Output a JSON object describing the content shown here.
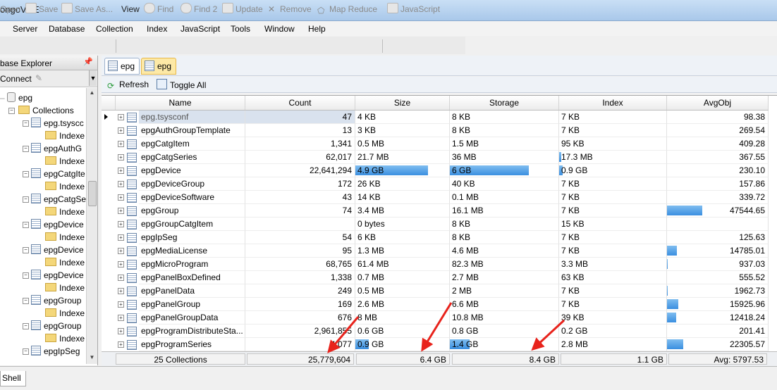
{
  "window": {
    "title": "ongoVUE"
  },
  "menu": [
    "Server",
    "Database",
    "Collection",
    "Index",
    "JavaScript",
    "Tools",
    "Window",
    "Help"
  ],
  "toolbar": {
    "open": "Open",
    "save": "Save",
    "save_as": "Save As...",
    "view": "View",
    "find": "Find",
    "find2": "Find 2",
    "update": "Update",
    "remove": "Remove",
    "map_reduce": "Map Reduce",
    "javascript": "JavaScript"
  },
  "explorer": {
    "title": "base Explorer",
    "connect": "Connect",
    "db": "epg",
    "collections_label": "Collections",
    "items": [
      "epg.tsyscc",
      "epgAuthG",
      "epgCatgIte",
      "epgCatgSe",
      "epgDevice",
      "epgDevice",
      "epgDevice",
      "epgGroup",
      "epgGroup",
      "epgIpSeg"
    ],
    "indexes_label": "Indexe"
  },
  "tabs": [
    "epg",
    "epg"
  ],
  "actions": {
    "refresh": "Refresh",
    "toggle_all": "Toggle All"
  },
  "grid": {
    "columns": [
      "Name",
      "Count",
      "Size",
      "Storage",
      "Index",
      "AvgObj"
    ],
    "rows": [
      {
        "name": "epg.tsysconf",
        "count": "47",
        "size": "4 KB",
        "storage": "8 KB",
        "index": "7 KB",
        "avg": "98.38"
      },
      {
        "name": "epgAuthGroupTemplate",
        "count": "13",
        "size": "3 KB",
        "storage": "8 KB",
        "index": "7 KB",
        "avg": "269.54"
      },
      {
        "name": "epgCatgItem",
        "count": "1,341",
        "size": "0.5 MB",
        "storage": "1.5 MB",
        "index": "95 KB",
        "avg": "409.28"
      },
      {
        "name": "epgCatgSeries",
        "count": "62,017",
        "size": "21.7 MB",
        "storage": "36 MB",
        "index": "17.3 MB",
        "avg": "367.55"
      },
      {
        "name": "epgDevice",
        "count": "22,641,294",
        "size": "4.9 GB",
        "storage": "6 GB",
        "index": "0.9 GB",
        "avg": "230.10"
      },
      {
        "name": "epgDeviceGroup",
        "count": "172",
        "size": "26 KB",
        "storage": "40 KB",
        "index": "7 KB",
        "avg": "157.86"
      },
      {
        "name": "epgDeviceSoftware",
        "count": "43",
        "size": "14 KB",
        "storage": "0.1 MB",
        "index": "7 KB",
        "avg": "339.72"
      },
      {
        "name": "epgGroup",
        "count": "74",
        "size": "3.4 MB",
        "storage": "16.1 MB",
        "index": "7 KB",
        "avg": "47544.65"
      },
      {
        "name": "epgGroupCatgItem",
        "count": "",
        "size": "0 bytes",
        "storage": "8 KB",
        "index": "15 KB",
        "avg": ""
      },
      {
        "name": "epgIpSeg",
        "count": "54",
        "size": "6 KB",
        "storage": "8 KB",
        "index": "7 KB",
        "avg": "125.63"
      },
      {
        "name": "epgMediaLicense",
        "count": "95",
        "size": "1.3 MB",
        "storage": "4.6 MB",
        "index": "7 KB",
        "avg": "14785.01"
      },
      {
        "name": "epgMicroProgram",
        "count": "68,765",
        "size": "61.4 MB",
        "storage": "82.3 MB",
        "index": "3.3 MB",
        "avg": "937.03"
      },
      {
        "name": "epgPanelBoxDefined",
        "count": "1,338",
        "size": "0.7 MB",
        "storage": "2.7 MB",
        "index": "63 KB",
        "avg": "555.52"
      },
      {
        "name": "epgPanelData",
        "count": "249",
        "size": "0.5 MB",
        "storage": "2 MB",
        "index": "7 KB",
        "avg": "1962.73"
      },
      {
        "name": "epgPanelGroup",
        "count": "169",
        "size": "2.6 MB",
        "storage": "6.6 MB",
        "index": "7 KB",
        "avg": "15925.96"
      },
      {
        "name": "epgPanelGroupData",
        "count": "676",
        "size": "8 MB",
        "storage": "10.8 MB",
        "index": "39 KB",
        "avg": "12418.24"
      },
      {
        "name": "epgProgramDistributeSta...",
        "count": "2,961,855",
        "size": "0.6 GB",
        "storage": "0.8 GB",
        "index": "0.2 GB",
        "avg": "201.41"
      },
      {
        "name": "epgProgramSeries",
        "count": "4,077",
        "size": "0.9 GB",
        "storage": "1.4 GB",
        "index": "2.8 MB",
        "avg": "22305.57"
      }
    ],
    "totals": {
      "collections": "25 Collections",
      "count": "25,779,604",
      "size": "6.4 GB",
      "storage": "8.4 GB",
      "index": "1.1 GB",
      "avg": "Avg: 5797.53"
    }
  },
  "bottom_tab": "Shell",
  "colors": {
    "bar": "#3b8fe0",
    "arrow": "#e8231c",
    "selected_tab": "#fde9a6"
  }
}
